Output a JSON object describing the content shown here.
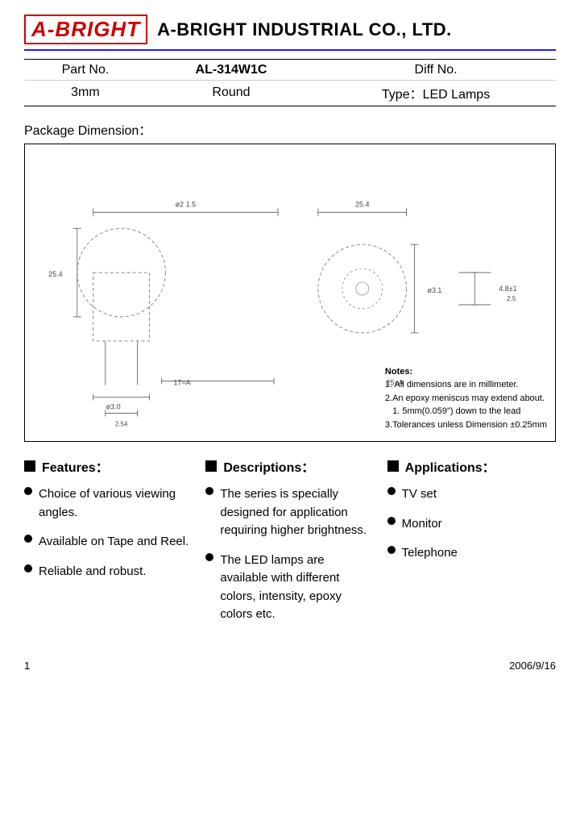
{
  "header": {
    "logo": "A-BRIGHT",
    "company": "A-BRIGHT INDUSTRIAL CO., LTD."
  },
  "part_info": {
    "part_no_label": "Part No.",
    "part_no_value": "AL-314W1C",
    "diff_no_label": "Diff No.",
    "size": "3mm",
    "shape": "Round",
    "type": "Type：LED Lamps"
  },
  "package": {
    "label": "Package Dimension："
  },
  "notes": {
    "title": "Notes:",
    "lines": [
      "1. All dimensions are in millimeter.",
      "2.An epoxy meniscus may extend about.",
      "   1. 5mm(0.059\") down to the lead",
      "3.Tolerances unless Dimension ±0.25mm"
    ]
  },
  "features": {
    "header": "Features：",
    "items": [
      "Choice of various viewing angles.",
      "Available on Tape and Reel.",
      "Reliable and robust."
    ]
  },
  "descriptions": {
    "header": "Descriptions：",
    "items": [
      "The series is specially designed for application requiring higher brightness.",
      "The LED lamps are available with different colors, intensity, epoxy colors etc."
    ]
  },
  "applications": {
    "header": "Applications：",
    "items": [
      "TV set",
      "Monitor",
      "Telephone"
    ]
  },
  "footer": {
    "page": "1",
    "date": "2006/9/16"
  }
}
